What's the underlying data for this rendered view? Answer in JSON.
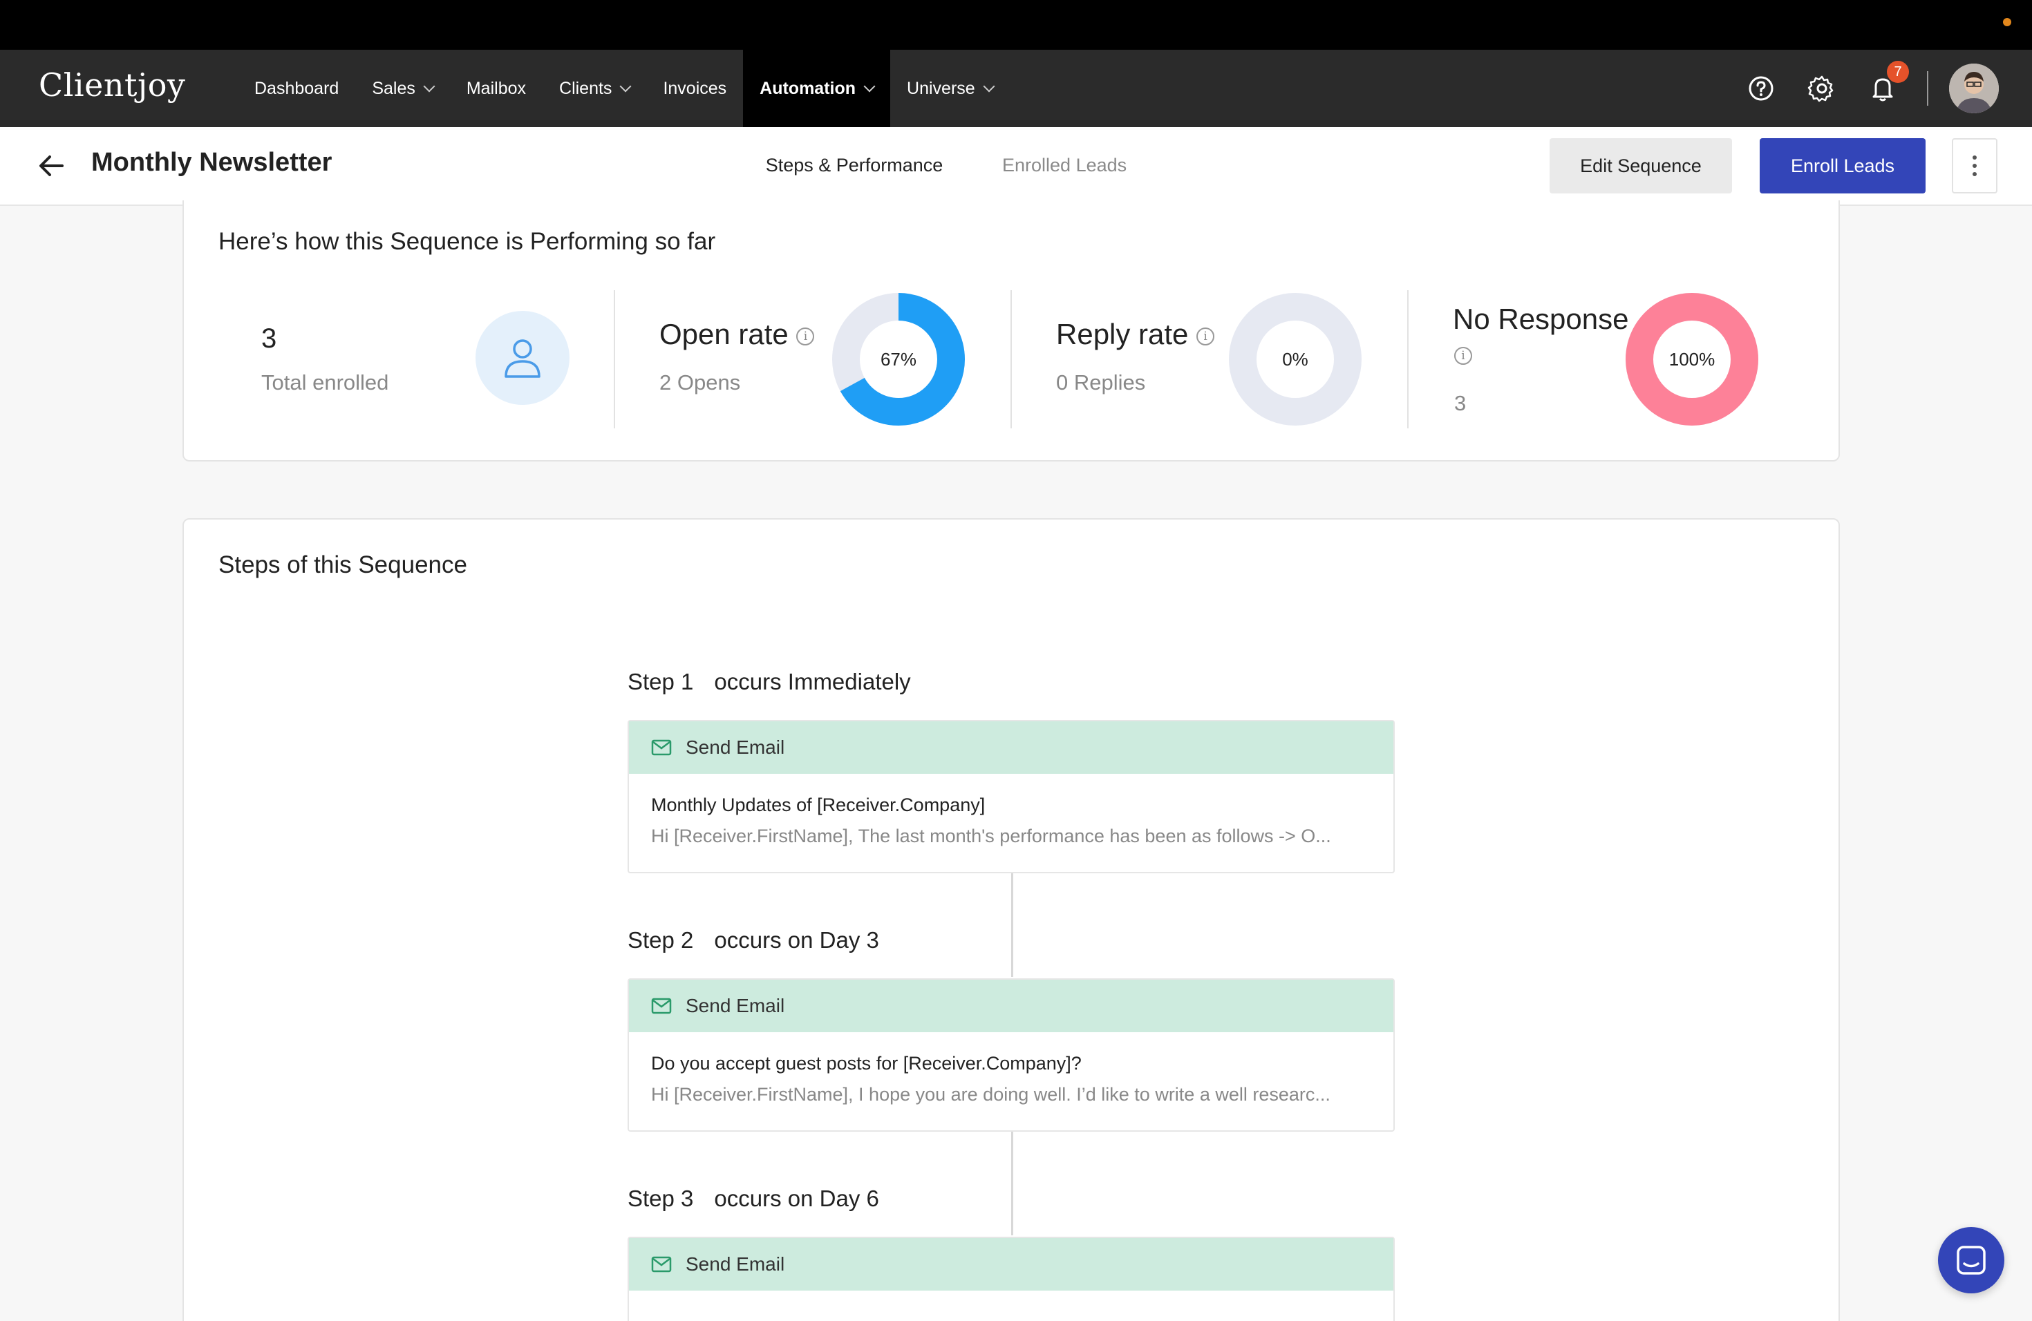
{
  "app": {
    "logo": "Clientjoy"
  },
  "nav": {
    "items": [
      {
        "label": "Dashboard",
        "dropdown": false,
        "active": false
      },
      {
        "label": "Sales",
        "dropdown": true,
        "active": false
      },
      {
        "label": "Mailbox",
        "dropdown": false,
        "active": false
      },
      {
        "label": "Clients",
        "dropdown": true,
        "active": false
      },
      {
        "label": "Invoices",
        "dropdown": false,
        "active": false
      },
      {
        "label": "Automation",
        "dropdown": true,
        "active": true
      },
      {
        "label": "Universe",
        "dropdown": true,
        "active": false
      }
    ],
    "notification_count": "7"
  },
  "header": {
    "title": "Monthly Newsletter",
    "tabs": [
      {
        "label": "Steps & Performance",
        "active": true
      },
      {
        "label": "Enrolled Leads",
        "active": false
      }
    ],
    "edit_label": "Edit Sequence",
    "enroll_label": "Enroll Leads"
  },
  "performance": {
    "title": "Here’s how this Sequence is Performing so far",
    "enrolled": {
      "value": "3",
      "label": "Total enrolled"
    },
    "open_rate": {
      "title": "Open rate",
      "sub": "2 Opens",
      "percent_label": "67%",
      "fraction": 0.67,
      "color": "#1f9ef5"
    },
    "reply_rate": {
      "title": "Reply rate",
      "sub": "0 Replies",
      "percent_label": "0%",
      "fraction": 0,
      "color": "#1f9ef5"
    },
    "no_response": {
      "title": "No Response",
      "sub": "3",
      "percent_label": "100%",
      "fraction": 1,
      "color": "#fd8198"
    }
  },
  "steps": {
    "title": "Steps of this Sequence",
    "items": [
      {
        "step": "Step 1",
        "timing": "occurs Immediately",
        "action": "Send Email",
        "subject": "Monthly Updates of [Receiver.Company]",
        "preview": "Hi [Receiver.FirstName],   The last month's performance has been as follows -> O..."
      },
      {
        "step": "Step 2",
        "timing": "occurs on Day 3",
        "action": "Send Email",
        "subject": "Do you accept guest posts for [Receiver.Company]?",
        "preview": "Hi [Receiver.FirstName],   I hope you are doing well. I’d like to write a well researc..."
      },
      {
        "step": "Step 3",
        "timing": "occurs on Day 6",
        "action": "Send Email",
        "subject": "",
        "preview": ""
      }
    ]
  }
}
